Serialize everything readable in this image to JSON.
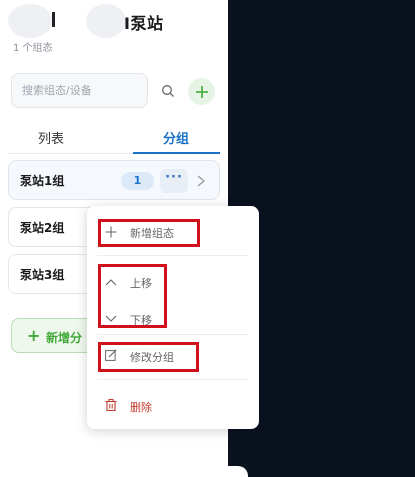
{
  "header": {
    "title": "I泵站",
    "subtitle": "1 个组态"
  },
  "search": {
    "placeholder": "搜索组态/设备"
  },
  "tabs": [
    {
      "label": "列表"
    },
    {
      "label": "分组"
    }
  ],
  "groups": [
    {
      "label": "泵站1组",
      "count": "1",
      "more": "···"
    },
    {
      "label": "泵站2组"
    },
    {
      "label": "泵站3组"
    }
  ],
  "add_group_button": {
    "plus": "+",
    "label": "新增分"
  },
  "context_menu": {
    "items": [
      {
        "label": "新增组态",
        "icon": "plus-icon"
      },
      {
        "label": "上移",
        "icon": "chevron-up-icon"
      },
      {
        "label": "下移",
        "icon": "chevron-down-icon"
      },
      {
        "label": "修改分组",
        "icon": "edit-icon"
      },
      {
        "label": "删除",
        "icon": "trash-icon"
      }
    ]
  },
  "colors": {
    "accent": "#1a73c8",
    "green": "#43a83a",
    "danger": "#c0392b",
    "highlight": "#d0101a",
    "background_dark": "#0a1220"
  }
}
